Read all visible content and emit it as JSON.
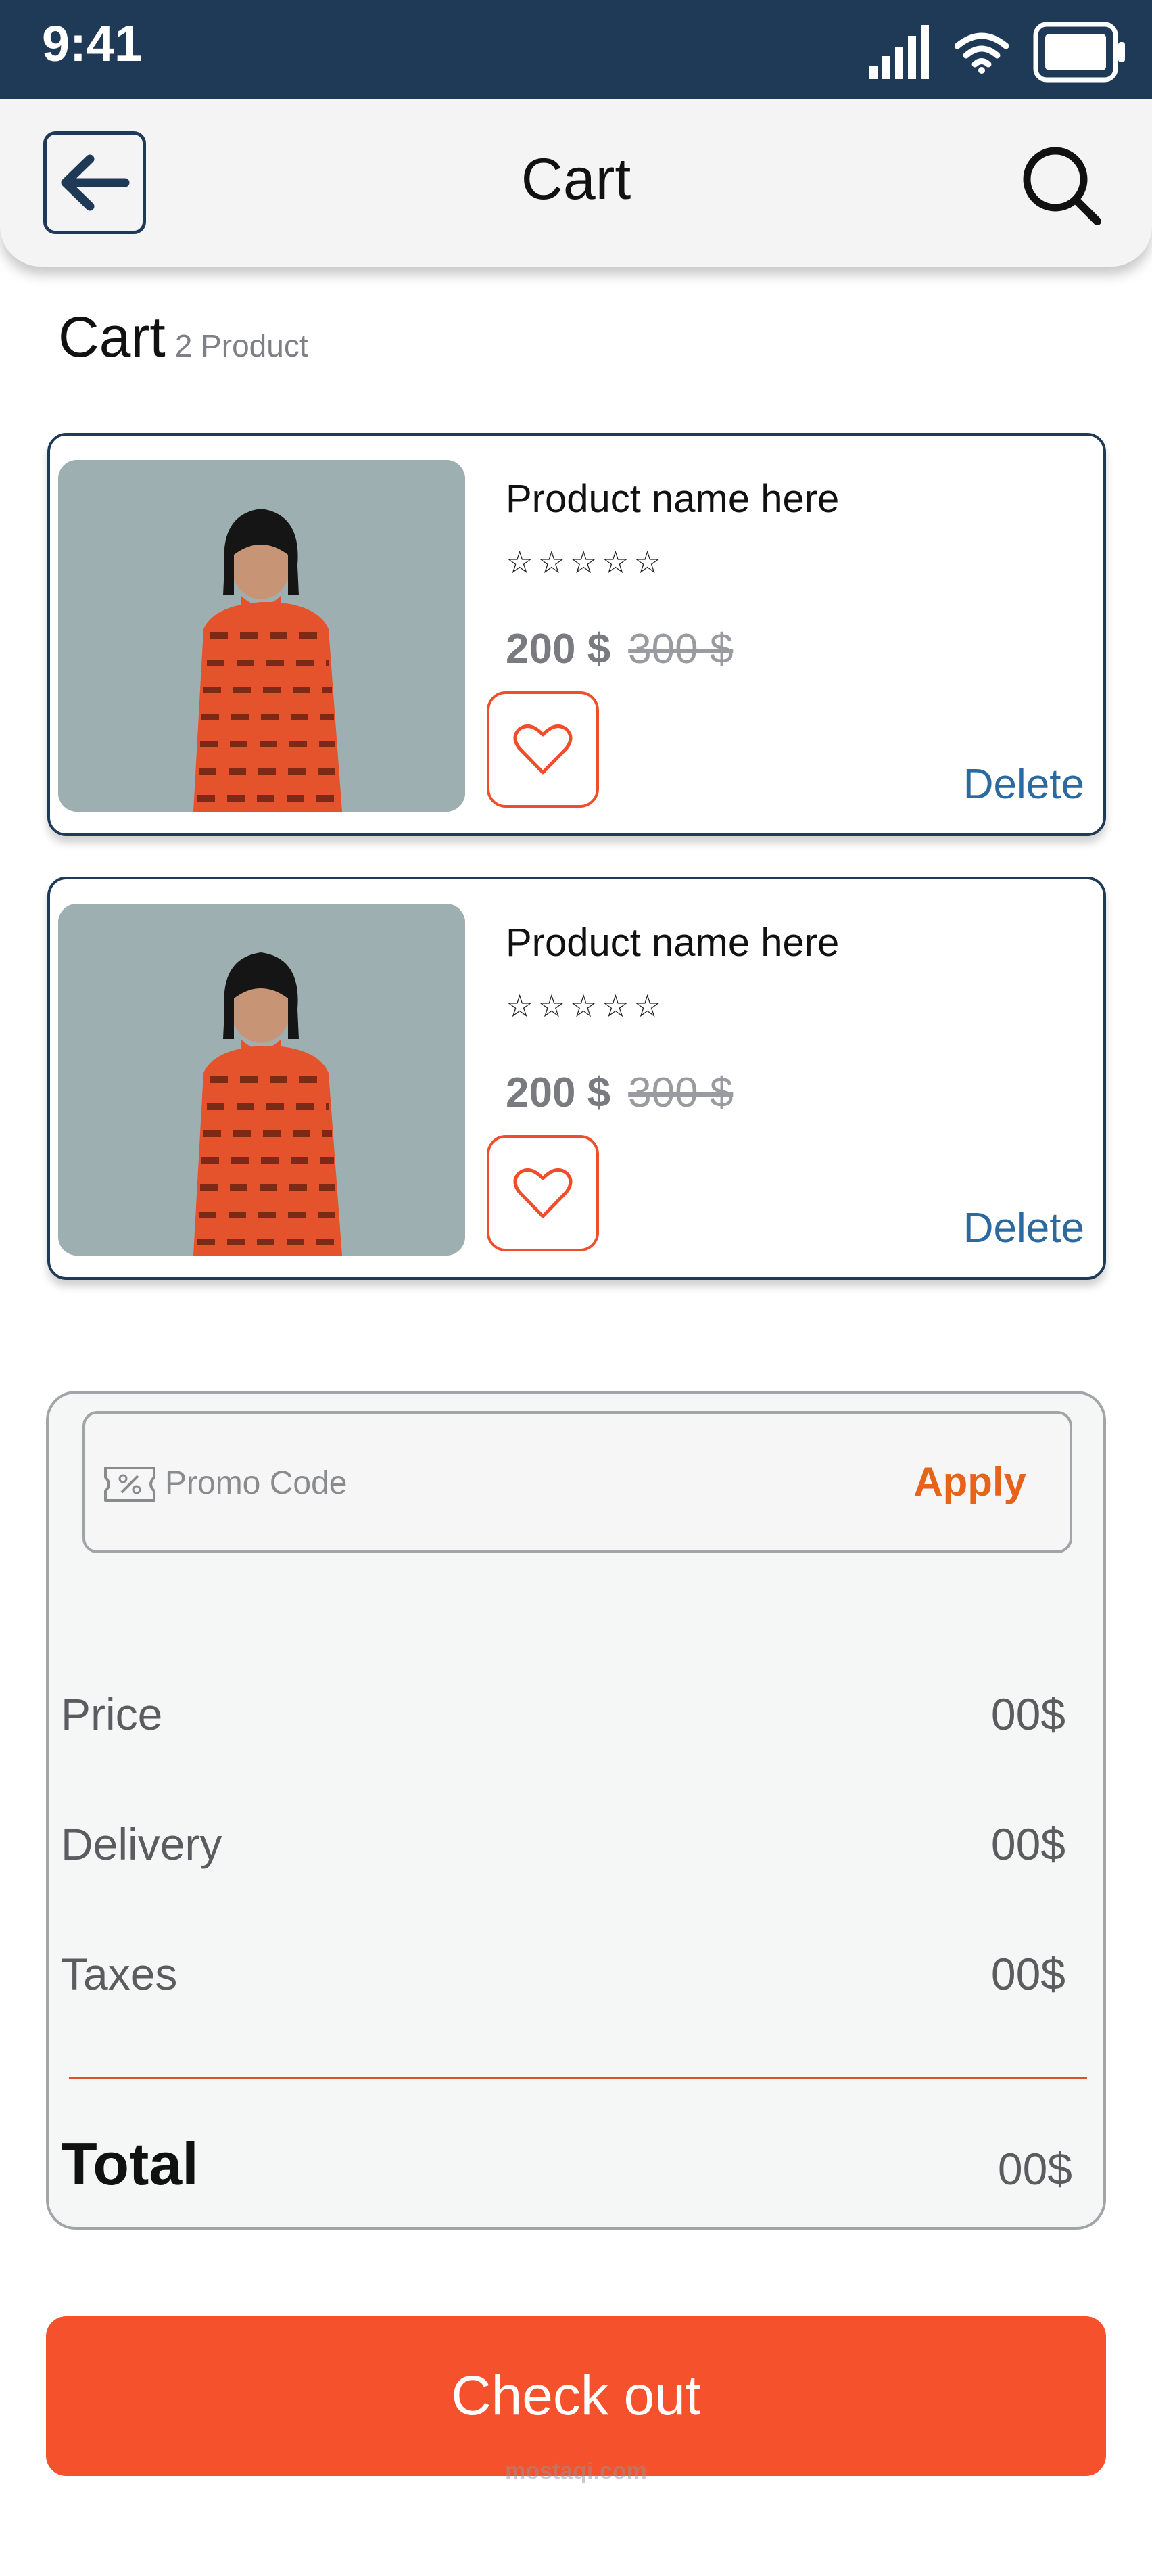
{
  "status_bar": {
    "time": "9:41",
    "icons": [
      "signal-icon",
      "wifi-icon",
      "battery-icon"
    ]
  },
  "app_bar": {
    "title": "Cart",
    "back_icon": "arrow-left-icon",
    "search_icon": "search-icon"
  },
  "cart": {
    "heading": "Cart",
    "count_label": "2 Product"
  },
  "products": [
    {
      "name": "Product name here",
      "rating": 0,
      "max_rating": 5,
      "stars": "☆☆☆☆☆",
      "price": "200 $",
      "old_price": "300 $",
      "delete_label": "Delete"
    },
    {
      "name": "Product name here",
      "rating": 0,
      "max_rating": 5,
      "stars": "☆☆☆☆☆",
      "price": "200 $",
      "old_price": "300 $",
      "delete_label": "Delete"
    }
  ],
  "promo": {
    "placeholder": "Promo Code",
    "apply_label": "Apply",
    "icon": "coupon-icon"
  },
  "summary": {
    "rows": [
      {
        "label": "Price",
        "value": "00$"
      },
      {
        "label": "Delivery",
        "value": "00$"
      },
      {
        "label": "Taxes",
        "value": "00$"
      }
    ],
    "total_label": "Total",
    "total_value": "00$"
  },
  "checkout": {
    "label": "Check out"
  },
  "watermark": {
    "text": "mostaqi.com"
  },
  "colors": {
    "status_bar": "#1f3a57",
    "accent": "#f4512c",
    "link": "#2a6aa0",
    "apply": "#e8631a"
  }
}
